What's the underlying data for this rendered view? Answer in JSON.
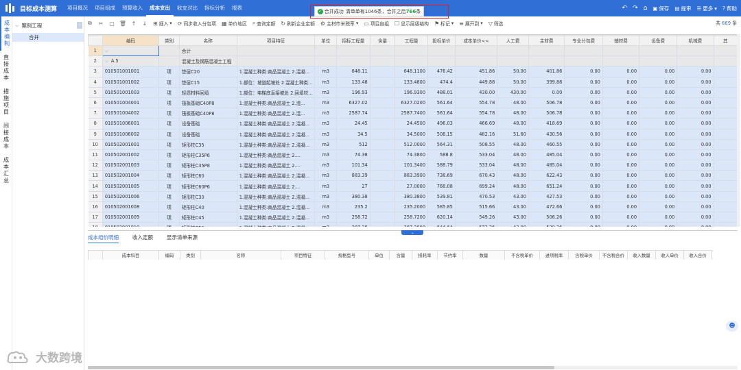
{
  "app": {
    "title": "目标成本测算"
  },
  "nav": [
    {
      "label": "项目概况"
    },
    {
      "label": "项目组成"
    },
    {
      "label": "预算收入"
    },
    {
      "label": "成本支出",
      "active": true
    },
    {
      "label": "收支对比"
    },
    {
      "label": "指标分析"
    },
    {
      "label": "报表"
    }
  ],
  "top_actions": {
    "save": "保存",
    "submit": "提审",
    "more": "更多",
    "help": "帮助"
  },
  "toast": {
    "title": "合并成功",
    "prefix": "清单单有",
    "before": "1046",
    "mid": "条，合并之后",
    "after": "766",
    "suffix": "条"
  },
  "vtabs": [
    {
      "label": "成本编制",
      "active": true
    },
    {
      "label": "直接成本"
    },
    {
      "label": "措施项目"
    },
    {
      "label": "间接成本"
    },
    {
      "label": "成本汇总"
    }
  ],
  "tree": {
    "root": "案例工程",
    "child": "合并"
  },
  "toolbar": {
    "insert": "插入",
    "sync": "同步收入分包项",
    "unit_price_area": "单价地区",
    "query_quota": "查询定额",
    "refresh_enterprise": "刷新企业定额",
    "main_material": "主材市米税率",
    "project_own": "项目自组",
    "show_tree": "显示层级结构",
    "mark": "标记",
    "expand": "展开到",
    "filter": "筛选",
    "total_prefix": "共",
    "total_num": "669",
    "total_suffix": "条"
  },
  "grid": {
    "columns": [
      "编码",
      "类别",
      "名称",
      "项目特征",
      "单位",
      "招标工程量",
      "含量",
      "工程量",
      "投标单价",
      "成本单价<<",
      "人工费",
      "主材费",
      "专业分包费",
      "辅材费",
      "设备费",
      "机械费",
      "其"
    ],
    "rows": [
      {
        "n": "1",
        "code": "",
        "type": "",
        "name": "合计",
        "feat": "",
        "unit": "",
        "bid_qty": "",
        "content": "",
        "qty": "",
        "bid_price": "",
        "cost_price": "",
        "labor": "",
        "main": "",
        "sub": "",
        "aux": "",
        "equip": "",
        "mach": "",
        "hl": true
      },
      {
        "n": "2",
        "code": "A.5",
        "type": "",
        "name": "混凝土及钢筋混凝土工程",
        "feat": "",
        "unit": "",
        "bid_qty": "",
        "content": "",
        "qty": "",
        "bid_price": "",
        "cost_price": "",
        "labor": "",
        "main": "",
        "sub": "",
        "aux": "",
        "equip": "",
        "mach": "",
        "hl": true
      },
      {
        "n": "3",
        "code": "010501001001",
        "type": "项",
        "name": "垫层C20",
        "feat": "1.混凝土种类:商品混凝土 2.混凝...",
        "unit": "m3",
        "bid_qty": "648.11",
        "content": "",
        "qty": "648.1100",
        "bid_price": "476.42",
        "cost_price": "451.86",
        "labor": "50.00",
        "main": "401.86",
        "sub": "0.00",
        "aux": "0.00",
        "equip": "0.00",
        "mach": "0.00"
      },
      {
        "n": "4",
        "code": "010501001002",
        "type": "项",
        "name": "垫层C15",
        "feat": "1.部位：坡道起坡处 2.混凝土种类...",
        "unit": "m3",
        "bid_qty": "133.48",
        "content": "",
        "qty": "133.4800",
        "bid_price": "474.4",
        "cost_price": "449.88",
        "labor": "50.00",
        "main": "399.88",
        "sub": "0.00",
        "aux": "0.00",
        "equip": "0.00",
        "mach": "0.00"
      },
      {
        "n": "5",
        "code": "010501001003",
        "type": "项",
        "name": "轻质材料回填",
        "feat": "1.部位：电梯底直接坡处 2.回填材...",
        "unit": "m3",
        "bid_qty": "196.93",
        "content": "",
        "qty": "196.9300",
        "bid_price": "488.01",
        "cost_price": "430.00",
        "labor": "430.00",
        "main": "0.00",
        "sub": "0.00",
        "aux": "0.00",
        "equip": "0.00",
        "mach": "0.00"
      },
      {
        "n": "6",
        "code": "010501004001",
        "type": "项",
        "name": "筏板基础C40P8",
        "feat": "1.混凝土种类:商品混凝土 2.混...",
        "unit": "m3",
        "bid_qty": "6327.02",
        "content": "",
        "qty": "6327.0200",
        "bid_price": "561.64",
        "cost_price": "554.78",
        "labor": "48.00",
        "main": "506.78",
        "sub": "0.00",
        "aux": "0.00",
        "equip": "0.00",
        "mach": "0.00"
      },
      {
        "n": "7",
        "code": "010501004002",
        "type": "项",
        "name": "筏板基础C40P8",
        "feat": "1.混凝土种类:商品混凝土 2.混...",
        "unit": "m3",
        "bid_qty": "2587.74",
        "content": "",
        "qty": "2587.7400",
        "bid_price": "561.64",
        "cost_price": "554.78",
        "labor": "48.00",
        "main": "506.78",
        "sub": "0.00",
        "aux": "0.00",
        "equip": "0.00",
        "mach": "0.00"
      },
      {
        "n": "8",
        "code": "010501006001",
        "type": "项",
        "name": "设备基础",
        "feat": "1.混凝土种类:商品混凝土 2.混凝...",
        "unit": "m3",
        "bid_qty": "24.45",
        "content": "",
        "qty": "24.4500",
        "bid_price": "496.03",
        "cost_price": "466.69",
        "labor": "48.00",
        "main": "418.69",
        "sub": "0.00",
        "aux": "0.00",
        "equip": "0.00",
        "mach": "0.00"
      },
      {
        "n": "9",
        "code": "010501006002",
        "type": "项",
        "name": "设备基础",
        "feat": "1.混凝土种类:商品混凝土 2.混凝...",
        "unit": "m3",
        "bid_qty": "34.5",
        "content": "",
        "qty": "34.5000",
        "bid_price": "508.15",
        "cost_price": "482.16",
        "labor": "51.60",
        "main": "430.56",
        "sub": "0.00",
        "aux": "0.00",
        "equip": "0.00",
        "mach": "0.00"
      },
      {
        "n": "10",
        "code": "010502001001",
        "type": "项",
        "name": "矩形柱C35",
        "feat": "1.混凝土种类:商品混凝土 2.混凝...",
        "unit": "m3",
        "bid_qty": "512",
        "content": "",
        "qty": "512.0000",
        "bid_price": "564.31",
        "cost_price": "508.55",
        "labor": "48.00",
        "main": "460.55",
        "sub": "0.00",
        "aux": "0.00",
        "equip": "0.00",
        "mach": "0.00"
      },
      {
        "n": "11",
        "code": "010502001002",
        "type": "项",
        "name": "矩形柱C35P6",
        "feat": "1.混凝土种类:商品混凝土 2....",
        "unit": "m3",
        "bid_qty": "74.38",
        "content": "",
        "qty": "74.3800",
        "bid_price": "588.8",
        "cost_price": "533.04",
        "labor": "48.00",
        "main": "485.04",
        "sub": "0.00",
        "aux": "0.00",
        "equip": "0.00",
        "mach": "0.00"
      },
      {
        "n": "12",
        "code": "010502001003",
        "type": "项",
        "name": "矩形柱C35P8",
        "feat": "1.混凝土种类:商品混凝土 2....",
        "unit": "m3",
        "bid_qty": "101.34",
        "content": "",
        "qty": "101.3400",
        "bid_price": "588.79",
        "cost_price": "533.04",
        "labor": "48.00",
        "main": "485.04",
        "sub": "0.00",
        "aux": "0.00",
        "equip": "0.00",
        "mach": "0.00"
      },
      {
        "n": "13",
        "code": "010502001004",
        "type": "项",
        "name": "矩形柱C60",
        "feat": "1.混凝土种类:商品混凝土 2.混凝...",
        "unit": "m3",
        "bid_qty": "883.39",
        "content": "",
        "qty": "883.3900",
        "bid_price": "738.69",
        "cost_price": "670.43",
        "labor": "48.00",
        "main": "622.43",
        "sub": "0.00",
        "aux": "0.00",
        "equip": "0.00",
        "mach": "0.00"
      },
      {
        "n": "14",
        "code": "010502001005",
        "type": "项",
        "name": "矩形柱C60P6",
        "feat": "1.混凝土种类:商品混凝土 2....",
        "unit": "m3",
        "bid_qty": "27",
        "content": "",
        "qty": "27.0000",
        "bid_price": "768.08",
        "cost_price": "699.24",
        "labor": "48.00",
        "main": "651.24",
        "sub": "0.00",
        "aux": "0.00",
        "equip": "0.00",
        "mach": "0.00"
      },
      {
        "n": "15",
        "code": "010502001006",
        "type": "项",
        "name": "矩形柱C30",
        "feat": "1.混凝土种类:商品混凝土 2.混凝...",
        "unit": "m3",
        "bid_qty": "380.38",
        "content": "",
        "qty": "380.3800",
        "bid_price": "539.81",
        "cost_price": "470.53",
        "labor": "43.00",
        "main": "427.53",
        "sub": "0.00",
        "aux": "0.00",
        "equip": "0.00",
        "mach": "0.00"
      },
      {
        "n": "16",
        "code": "010502001008",
        "type": "项",
        "name": "矩形柱C40",
        "feat": "1.混凝土种类:商品混凝土 2.混凝...",
        "unit": "m3",
        "bid_qty": "235.2",
        "content": "",
        "qty": "235.2000",
        "bid_price": "585.85",
        "cost_price": "515.66",
        "labor": "43.00",
        "main": "472.66",
        "sub": "0.00",
        "aux": "0.00",
        "equip": "0.00",
        "mach": "0.00"
      },
      {
        "n": "17",
        "code": "010502001009",
        "type": "项",
        "name": "矩形柱C45",
        "feat": "1.混凝土种类:商品混凝土 2.混凝...",
        "unit": "m3",
        "bid_qty": "258.72",
        "content": "",
        "qty": "258.7200",
        "bid_price": "620.14",
        "cost_price": "549.26",
        "labor": "43.00",
        "main": "506.26",
        "sub": "0.00",
        "aux": "0.00",
        "equip": "0.00",
        "mach": "0.00"
      },
      {
        "n": "18",
        "code": "010502001010",
        "type": "项",
        "name": "矩形柱C50",
        "feat": "1.混凝土种类:商品混凝土 2.混凝...",
        "unit": "m3",
        "bid_qty": "287.28",
        "content": "",
        "qty": "287.2800",
        "bid_price": "644.64",
        "cost_price": "573.26",
        "labor": "43.00",
        "main": "530.26",
        "sub": "0.00",
        "aux": "0.00",
        "equip": "0.00",
        "mach": "0.00"
      }
    ]
  },
  "bottom_tabs": [
    {
      "label": "成本组价明细",
      "active": true
    },
    {
      "label": "收入定额"
    },
    {
      "label": "显示清单来源"
    }
  ],
  "grid2": {
    "columns": [
      "成本科目",
      "编码",
      "类别",
      "名称",
      "项目特征",
      "规格型号",
      "单位",
      "含量",
      "损耗率",
      "节约率",
      "数量",
      "不含税单价",
      "进项税率",
      "含税单价",
      "不含税合价",
      "收入数量",
      "收入单价",
      "收入合价"
    ]
  },
  "watermark": {
    "text": "大数跨境"
  },
  "colors": {
    "brand": "#2f6fd6",
    "row_fill": "#dbe6f8",
    "highlight": "#e02020",
    "success": "#28a745"
  }
}
